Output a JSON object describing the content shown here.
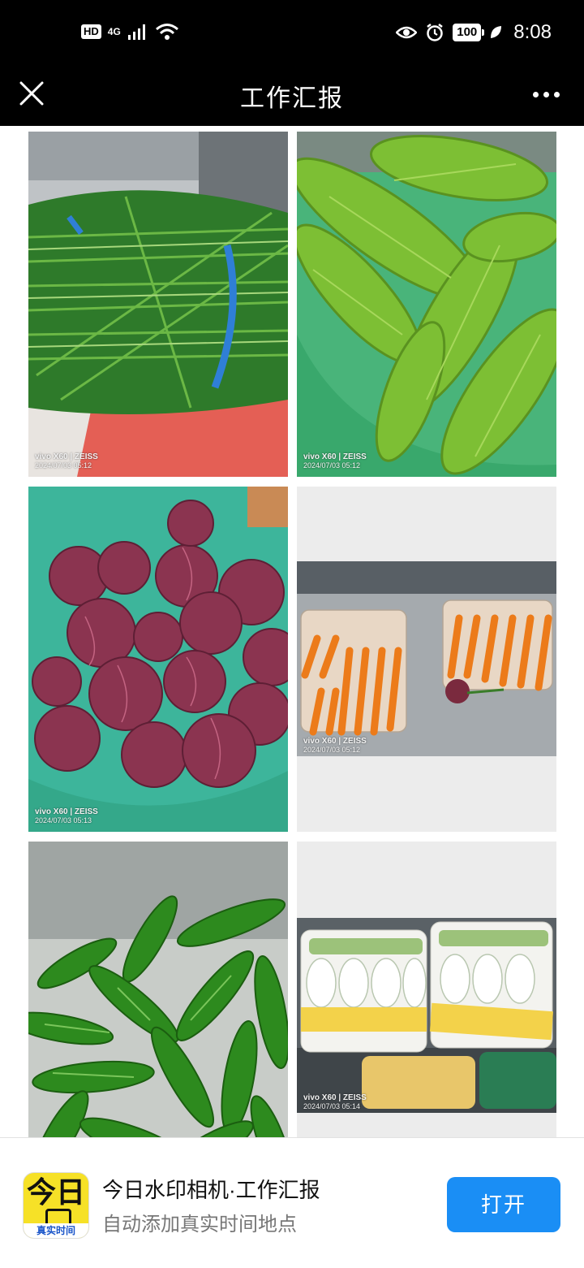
{
  "status_bar": {
    "hd_badge": "HD",
    "network": "4G",
    "battery": "100",
    "time": "8:08",
    "icons": [
      "signal-icon",
      "wifi-icon",
      "eye-icon",
      "alarm-icon",
      "battery-icon",
      "leaf-icon"
    ]
  },
  "nav": {
    "title": "工作汇报",
    "close_icon": "close-icon",
    "more_icon": "more-icon"
  },
  "photos": [
    {
      "subject": "green chives",
      "watermark_brand": "vivo X60 | ZEISS",
      "watermark_time": "2024/07/03 05:12"
    },
    {
      "subject": "bitter melons",
      "watermark_brand": "vivo X60 | ZEISS",
      "watermark_time": "2024/07/03 05:12"
    },
    {
      "subject": "red onions",
      "watermark_brand": "vivo X60 | ZEISS",
      "watermark_time": "2024/07/03 05:13"
    },
    {
      "subject": "carrots",
      "watermark_brand": "vivo X60 | ZEISS",
      "watermark_time": "2024/07/03 05:12"
    },
    {
      "subject": "green peppers",
      "watermark_brand": "",
      "watermark_time": ""
    },
    {
      "subject": "chinese cabbage",
      "watermark_brand": "vivo X60 | ZEISS",
      "watermark_time": "2024/07/03 05:14"
    }
  ],
  "banner": {
    "app_icon_text": "今日",
    "app_icon_strip": "真实时间",
    "app_name": "今日水印相机·工作汇报",
    "app_subtitle": "自动添加真实时间地点",
    "open_button": "打开"
  },
  "colors": {
    "nav_bg": "#000000",
    "button_blue": "#1a8ef5",
    "app_icon_yellow": "#f6e127"
  }
}
